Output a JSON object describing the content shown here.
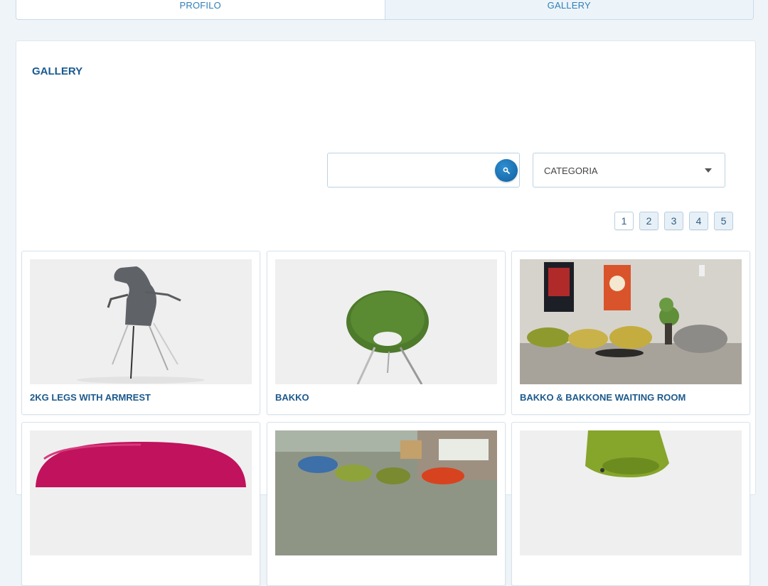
{
  "tabs": [
    {
      "label": "PROFILO"
    },
    {
      "label": "GALLERY"
    }
  ],
  "gallery": {
    "title": "GALLERY",
    "search": {
      "value": "",
      "placeholder": ""
    },
    "category": {
      "selected": "CATEGORIA"
    },
    "pages": [
      "1",
      "2",
      "3",
      "4",
      "5"
    ],
    "cards": [
      {
        "title": "2KG LEGS WITH ARMREST"
      },
      {
        "title": "BAKKO"
      },
      {
        "title": "BAKKO & BAKKONE WAITING ROOM"
      },
      {
        "title": ""
      },
      {
        "title": ""
      },
      {
        "title": ""
      }
    ]
  },
  "icons": {
    "search": "search-icon",
    "dropdown": "chevron-down-icon"
  },
  "colors": {
    "accent": "#1d5a8c",
    "search_button": "#1b6fb2",
    "background": "#eef4f8"
  }
}
